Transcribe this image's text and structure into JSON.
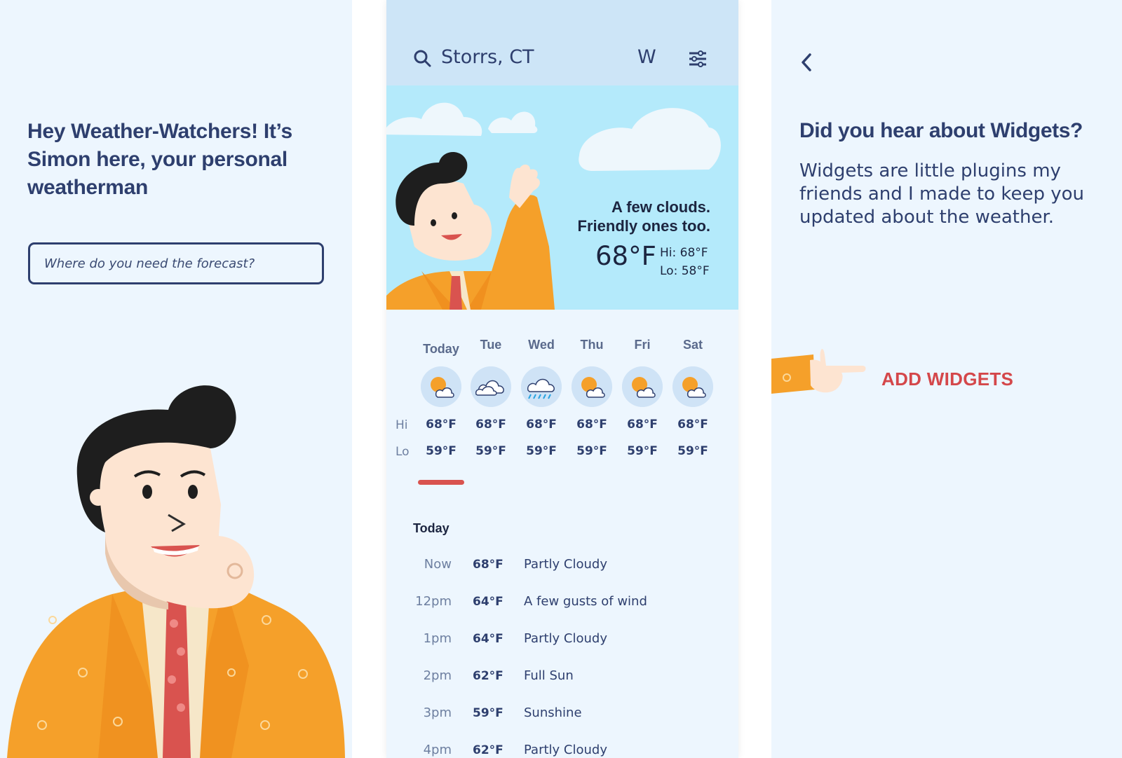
{
  "onboarding": {
    "greeting": "Hey Weather-Watchers! It’s Simon here, your personal weatherman",
    "search_placeholder": "Where do you need the forecast?"
  },
  "app": {
    "location": "Storrs, CT",
    "w_label": "W",
    "condition_line1": "A few clouds.",
    "condition_line2": "Friendly ones too.",
    "current_temp": "68°F",
    "hi": "Hi: 68°F",
    "lo": "Lo: 58°F",
    "row_hi_label": "Hi",
    "row_lo_label": "Lo",
    "days": [
      {
        "name": "Today",
        "icon": "partly-cloudy-icon",
        "hi": "68°F",
        "lo": "59°F"
      },
      {
        "name": "Tue",
        "icon": "cloudy-icon",
        "hi": "68°F",
        "lo": "59°F"
      },
      {
        "name": "Wed",
        "icon": "rain-icon",
        "hi": "68°F",
        "lo": "59°F"
      },
      {
        "name": "Thu",
        "icon": "partly-cloudy-icon",
        "hi": "68°F",
        "lo": "59°F"
      },
      {
        "name": "Fri",
        "icon": "partly-cloudy-icon",
        "hi": "68°F",
        "lo": "59°F"
      },
      {
        "name": "Sat",
        "icon": "partly-cloudy-icon",
        "hi": "68°F",
        "lo": "59°F"
      }
    ],
    "today_heading": "Today",
    "hourly": [
      {
        "time": "Now",
        "temp": "68°F",
        "desc": "Partly Cloudy"
      },
      {
        "time": "12pm",
        "temp": "64°F",
        "desc": "A few gusts of wind"
      },
      {
        "time": "1pm",
        "temp": "64°F",
        "desc": "Partly Cloudy"
      },
      {
        "time": "2pm",
        "temp": "62°F",
        "desc": "Full Sun"
      },
      {
        "time": "3pm",
        "temp": "59°F",
        "desc": "Sunshine"
      },
      {
        "time": "4pm",
        "temp": "62°F",
        "desc": "Partly Cloudy"
      }
    ]
  },
  "widgets": {
    "title": "Did you hear about Widgets?",
    "body": "Widgets are little plugins my friends and I made to keep you updated about the weather.",
    "add_label": "ADD WIDGETS"
  },
  "colors": {
    "navy": "#2e3f6e",
    "panel_bg": "#edf6fe",
    "header_bg": "#cde5f7",
    "sky": "#b4eafb",
    "accent_red": "#d4474a",
    "jacket_orange": "#f5a02a"
  }
}
